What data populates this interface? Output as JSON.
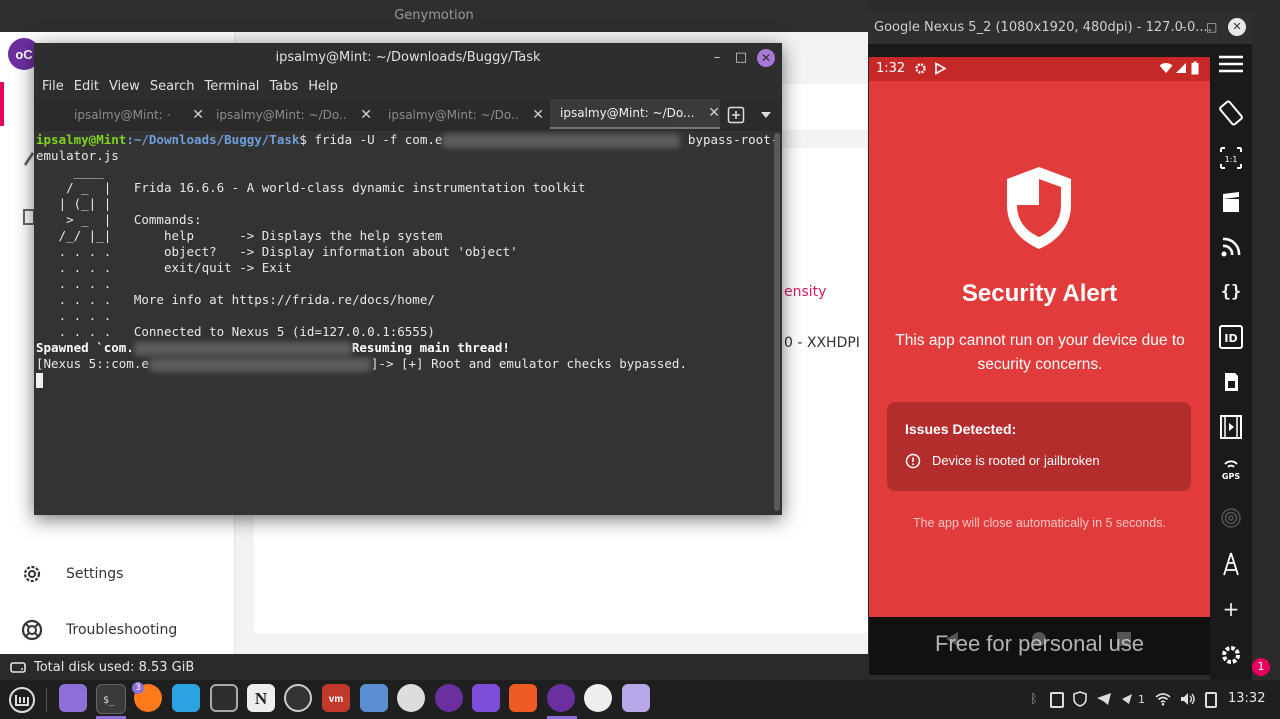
{
  "genymotion": {
    "window_title": "Genymotion",
    "sidebar": {
      "settings_label": "Settings",
      "troubleshooting_label": "Troubleshooting"
    },
    "content_partial": {
      "density_header": "ensity",
      "density_value": "0 - XXHDPI"
    },
    "disk_usage": "Total disk used: 8.53 GiB"
  },
  "terminal": {
    "window_title": "ipsalmy@Mint: ~/Downloads/Buggy/Task",
    "menu": [
      "File",
      "Edit",
      "View",
      "Search",
      "Terminal",
      "Tabs",
      "Help"
    ],
    "tabs": [
      {
        "label": "ipsalmy@Mint: ~"
      },
      {
        "label": "ipsalmy@Mint: ~/Do..."
      },
      {
        "label": "ipsalmy@Mint: ~/Do..."
      },
      {
        "label": "ipsalmy@Mint: ~/Do...",
        "active": true
      }
    ],
    "prompt": {
      "user_host": "ipsalmy@Mint",
      "path": ":~/Downloads/Buggy/Task",
      "symbol": "$",
      "command_start": " frida -U -f com.e",
      "command_end": " bypass-root-",
      "command_wrap": "emulator.js"
    },
    "banner": [
      {
        "art": "     ____",
        "text": ""
      },
      {
        "art": "    / _  |",
        "text": "   Frida 16.6.6 - A world-class dynamic instrumentation toolkit"
      },
      {
        "art": "   | (_| |",
        "text": ""
      },
      {
        "art": "    > _  |",
        "text": "   Commands:"
      },
      {
        "art": "   /_/ |_|",
        "text": "       help      -> Displays the help system"
      },
      {
        "art": "   . . . .",
        "text": "       object?   -> Display information about 'object'"
      },
      {
        "art": "   . . . .",
        "text": "       exit/quit -> Exit"
      },
      {
        "art": "   . . . .",
        "text": ""
      },
      {
        "art": "   . . . .",
        "text": "   More info at https://frida.re/docs/home/"
      },
      {
        "art": "   . . . .",
        "text": ""
      },
      {
        "art": "   . . . .",
        "text": "   Connected to Nexus 5 (id=127.0.0.1:6555)"
      }
    ],
    "spawned": {
      "start": "Spawned `com.",
      "end": "Resuming main thread!"
    },
    "result": {
      "start": "[Nexus 5::com.e",
      "end": "]-> [+] Root and emulator checks bypassed."
    }
  },
  "emulator": {
    "window_title": "Google Nexus 5_2 (1080x1920, 480dpi) - 127.0.0....",
    "status_time": "1:32",
    "alert_title": "Security Alert",
    "alert_message": "This app cannot run on your device due to security concerns.",
    "issues_header": "Issues Detected:",
    "issue_item": "Device is rooted or jailbroken",
    "auto_close": "The app will close automatically in 5 seconds.",
    "watermark": "Free for personal use",
    "side_badge": "1",
    "colors": {
      "screen": "#e23b3b",
      "status_bar": "#c62828",
      "issue_box": "#b32d2d"
    }
  },
  "taskbar": {
    "firefox_badge": "3",
    "clock": "13:32",
    "tray_count": "1"
  }
}
